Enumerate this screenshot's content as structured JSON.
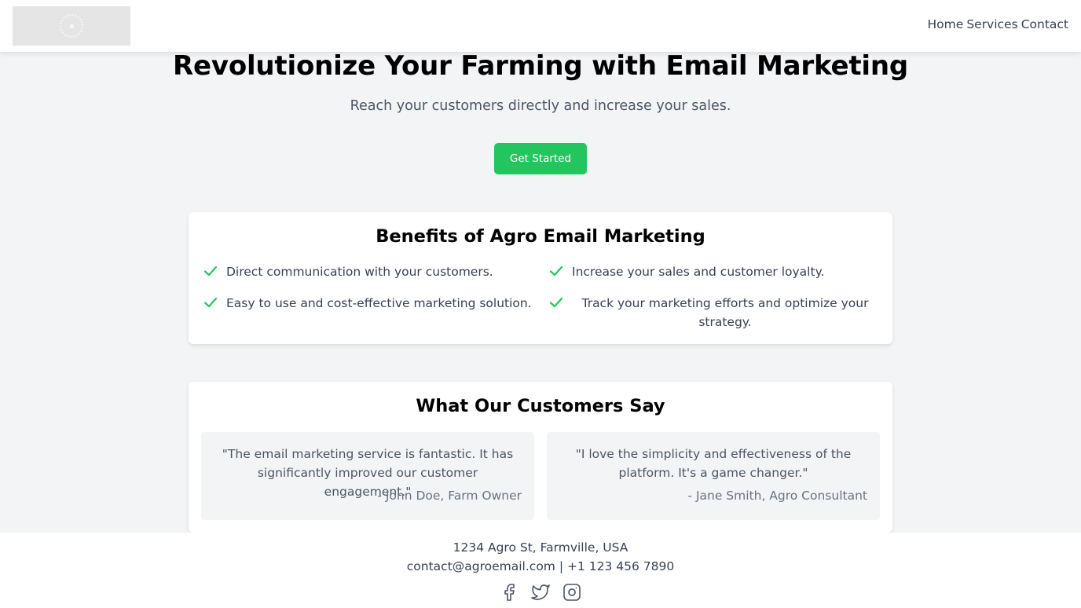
{
  "header": {
    "logo_alt": "logo",
    "nav": [
      "Home",
      "Services",
      "Contact"
    ]
  },
  "hero": {
    "title": "Revolutionize Your Farming with Email Marketing",
    "subtitle": "Reach your customers directly and increase your sales.",
    "cta_label": "Get Started"
  },
  "benefits": {
    "title": "Benefits of Agro Email Marketing",
    "items": [
      "Direct communication with your customers.",
      "Increase your sales and customer loyalty.",
      "Easy to use and cost-effective marketing solution.",
      "Track your marketing efforts and optimize your strategy."
    ]
  },
  "testimonials": {
    "title": "What Our Customers Say",
    "items": [
      {
        "quote": "\"The email marketing service is fantastic. It has significantly improved our customer engagement.\"",
        "author": "- John Doe, Farm Owner"
      },
      {
        "quote": "\"I love the simplicity and effectiveness of the platform. It's a game changer.\"",
        "author": "- Jane Smith, Agro Consultant"
      }
    ]
  },
  "footer": {
    "address": "1234 Agro St, Farmville, USA",
    "contact": "contact@agroemail.com | +1 123 456 7890",
    "socials": [
      "facebook-icon",
      "twitter-icon",
      "instagram-icon"
    ]
  },
  "colors": {
    "accent": "#22c55e",
    "background": "#f3f4f6",
    "card": "#ffffff",
    "text_muted": "#4b5563"
  }
}
